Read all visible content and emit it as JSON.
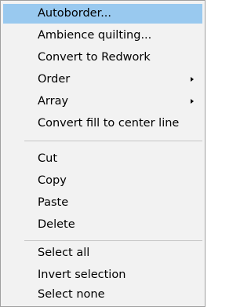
{
  "context_menu": {
    "groups": [
      [
        {
          "label": "Autoborder...",
          "highlighted": true,
          "submenu": false
        },
        {
          "label": "Ambience quilting...",
          "highlighted": false,
          "submenu": false
        },
        {
          "label": "Convert to Redwork",
          "highlighted": false,
          "submenu": false
        },
        {
          "label": "Order",
          "highlighted": false,
          "submenu": true,
          "submenu_icon": "triangle-right-icon"
        },
        {
          "label": "Array",
          "highlighted": false,
          "submenu": true,
          "submenu_icon": "triangle-right-icon"
        },
        {
          "label": "Convert fill to center line",
          "highlighted": false,
          "submenu": false
        }
      ],
      [
        {
          "label": "Cut",
          "highlighted": false,
          "submenu": false
        },
        {
          "label": "Copy",
          "highlighted": false,
          "submenu": false
        },
        {
          "label": "Paste",
          "highlighted": false,
          "submenu": false
        },
        {
          "label": "Delete",
          "highlighted": false,
          "submenu": false
        }
      ],
      [
        {
          "label": "Select all",
          "highlighted": false,
          "submenu": false
        },
        {
          "label": "Invert selection",
          "highlighted": false,
          "submenu": false
        },
        {
          "label": "Select none",
          "highlighted": false,
          "submenu": false
        }
      ]
    ],
    "colors": {
      "background": "#f2f2f2",
      "highlight": "#99c9ef",
      "border": "#a0a0a0",
      "separator": "#c6c6c6",
      "text": "#000000"
    }
  }
}
